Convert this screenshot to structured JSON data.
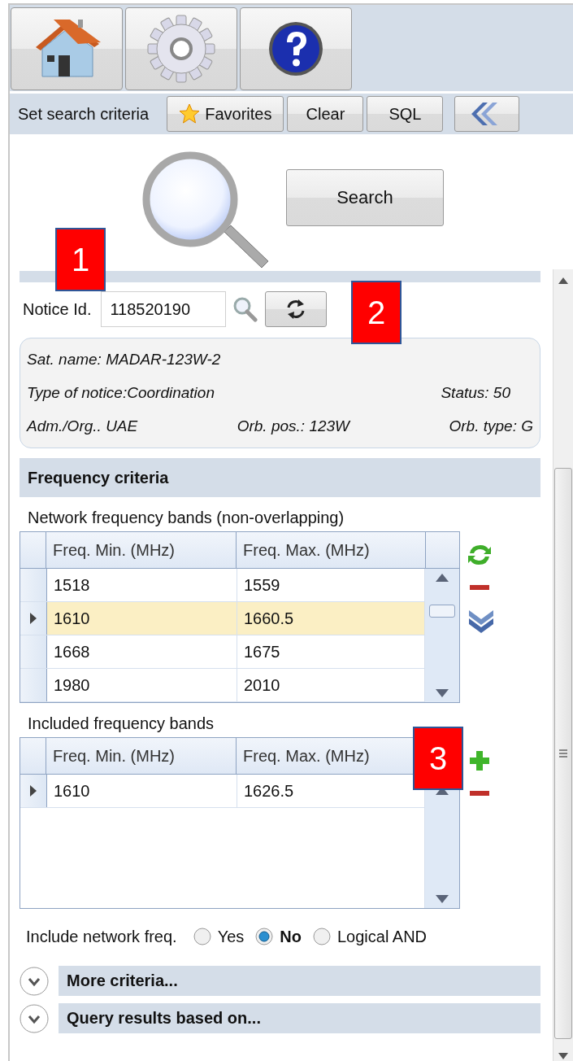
{
  "header": {
    "title": "Set search criteria",
    "buttons": [
      {
        "label": "Favorites",
        "kind": "favorites"
      },
      {
        "label": "Clear",
        "kind": "text"
      },
      {
        "label": "SQL",
        "kind": "text"
      }
    ]
  },
  "search_button": {
    "label": "Search"
  },
  "notice": {
    "label": "Notice Id.",
    "value": "118520190"
  },
  "info": {
    "sat_name": "Sat. name: MADAR-123W-2",
    "notice_type": "Type of notice:Coordination",
    "status": "Status: 50",
    "administration": "Adm./Org.. UAE",
    "orbital_position": "Orb. pos.: 123W",
    "orbital_type": "Orb. type: G"
  },
  "frequency_criteria": {
    "title": "Frequency criteria"
  },
  "network_bands": {
    "label": "Network frequency bands (non-overlapping)",
    "columns": [
      "Freq. Min. (MHz)",
      "Freq. Max. (MHz)"
    ],
    "rows": [
      {
        "cells": [
          "1518",
          "1559"
        ],
        "selected": false,
        "current": false
      },
      {
        "cells": [
          "1610",
          "1660.5"
        ],
        "selected": true,
        "current": true
      },
      {
        "cells": [
          "1668",
          "1675"
        ],
        "selected": false,
        "current": false
      },
      {
        "cells": [
          "1980",
          "2010"
        ],
        "selected": false,
        "current": false
      }
    ],
    "actions": [
      {
        "kind": "refresh"
      },
      {
        "kind": "remove"
      },
      {
        "kind": "move-down"
      }
    ]
  },
  "included_bands": {
    "label": "Included frequency bands",
    "columns": [
      "Freq. Min. (MHz)",
      "Freq. Max. (MHz)"
    ],
    "rows": [
      {
        "cells": [
          "1610",
          "1626.5"
        ],
        "selected": false,
        "current": true
      }
    ],
    "actions": [
      {
        "kind": "add"
      },
      {
        "kind": "remove"
      }
    ]
  },
  "include_network": {
    "label": "Include network freq.",
    "options": [
      {
        "label": "Yes",
        "selected": false
      },
      {
        "label": "No",
        "selected": true
      },
      {
        "label": "Logical AND",
        "selected": false
      }
    ]
  },
  "expanders": [
    {
      "title": "More criteria...",
      "expanded": false
    },
    {
      "title": "Query results based on...",
      "expanded": false
    }
  ],
  "callouts": [
    {
      "label": "1"
    },
    {
      "label": "2"
    },
    {
      "label": "3"
    }
  ]
}
